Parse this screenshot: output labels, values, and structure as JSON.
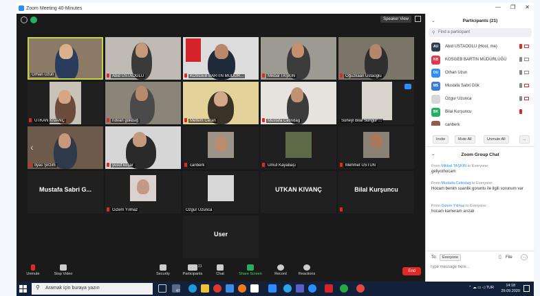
{
  "window": {
    "title": "Zoom Meeting 40-Minutes"
  },
  "meeting": {
    "speaker_view_label": "Speaker View",
    "tiles": [
      {
        "name": "Orhan Uzun",
        "muted": false
      },
      {
        "name": "Abid USTAOGLU",
        "muted": true
      },
      {
        "name": "KOSGEB BARTIN MÜDÜR...",
        "muted": true
      },
      {
        "name": "Mikbal TAŞKIN",
        "muted": true
      },
      {
        "name": "Oğuzkaan Ustaoglu",
        "muted": true
      },
      {
        "name": "UTKAN KIVANÇ",
        "muted": true
      },
      {
        "name": "rıdvan gökdağ",
        "muted": true
      },
      {
        "name": "Meltem Ceran",
        "muted": true
      },
      {
        "name": "Mustafa Cetindag",
        "muted": true
      },
      {
        "name": "Süheyl Bilal Sungur ...",
        "muted": false
      },
      {
        "name": "İlyas Şirzim",
        "muted": true
      },
      {
        "name": "yusuf koşar",
        "muted": true
      },
      {
        "name": "canberk",
        "muted": true
      },
      {
        "name": "Umut Kayabaşı",
        "muted": true
      },
      {
        "name": "Mehmet ÜSTÜN",
        "muted": true
      },
      {
        "name": "Mustafa Sabri G...",
        "muted": false,
        "text_only": true
      },
      {
        "name": "Gizem Yılmaz",
        "muted": true
      },
      {
        "name": "Ozgur Uzunca",
        "muted": false
      },
      {
        "name": "UTKAN KIVANÇ",
        "muted": false,
        "text_only": true
      },
      {
        "name": "Bilal Kurşuncu",
        "muted": true,
        "text_only": true
      },
      {
        "name": "User",
        "muted": false,
        "text_only": true
      }
    ],
    "controls": {
      "unmute": "Unmute",
      "stop_video": "Stop Video",
      "security": "Security",
      "participants": "Participants",
      "participants_count": "21",
      "chat": "Chat",
      "share_screen": "Share Screen",
      "record": "Record",
      "reactions": "Reactions",
      "end": "End"
    }
  },
  "participants_panel": {
    "title": "Participants (21)",
    "search_placeholder": "Find a participant",
    "list": [
      {
        "initials": "AU",
        "name": "Abid USTAOGLU (Host, me)",
        "color": "#2c3e50"
      },
      {
        "initials": "KB",
        "name": "KOSGEB BARTIN MÜDÜRLÜĞÜ",
        "color": "#e0394a"
      },
      {
        "initials": "OU",
        "name": "Orhan Uzun",
        "color": "#2d8cff"
      },
      {
        "initials": "MS",
        "name": "Mustafa Sabri Gök",
        "color": "#3a7bd5"
      },
      {
        "initials": "",
        "name": "Ozgur Uzunca",
        "color": "#d7d7d7"
      },
      {
        "initials": "BK",
        "name": "Bilal Kurşuncu",
        "color": "#27ae60"
      },
      {
        "initials": "",
        "name": "canberk",
        "color": "#8e5c4a"
      }
    ],
    "buttons": {
      "invite": "Invite",
      "mute_all": "Mute All",
      "unmute_all": "Unmute All",
      "more": "..."
    }
  },
  "chat_panel": {
    "title": "Zoom Group Chat",
    "messages": [
      {
        "from_prefix": "From",
        "sender": "Mikbal TAŞKIN",
        "to": "to Everyone:",
        "text": "geliyorhocam"
      },
      {
        "from_prefix": "From",
        "sender": "Mustafa Cetindag",
        "to": "to Everyone:",
        "text": "Hocam benim suanlik goruntu ile ilgili sorunum var"
      },
      {
        "from_prefix": "From",
        "sender": "Gizem Yılmaz",
        "to": "to Everyone:",
        "text": "hocam kameram arızalı"
      }
    ],
    "to_label": "To:",
    "to_value": "Everyone",
    "file_label": "File",
    "input_placeholder": "Type message here..."
  },
  "taskbar": {
    "search_placeholder": "Aramak için buraya yazın",
    "lang": "TUR",
    "time": "14:18",
    "date": "29.09.2020",
    "badge": "47"
  }
}
